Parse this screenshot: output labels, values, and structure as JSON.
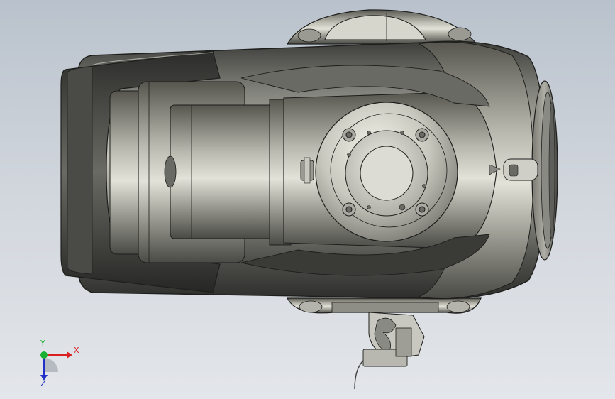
{
  "viewport": {
    "background_top": "#b9c2cc",
    "background_bottom": "#e3e6ea"
  },
  "model": {
    "body_color": "#5a5a56",
    "highlight_color": "#d8d8d0",
    "outline_color": "#1e1e1c"
  },
  "triad": {
    "x_label": "X",
    "y_label": "Y",
    "z_label": "Z",
    "x_color": "#d82020",
    "y_color": "#18b030",
    "z_color": "#2030c8"
  }
}
